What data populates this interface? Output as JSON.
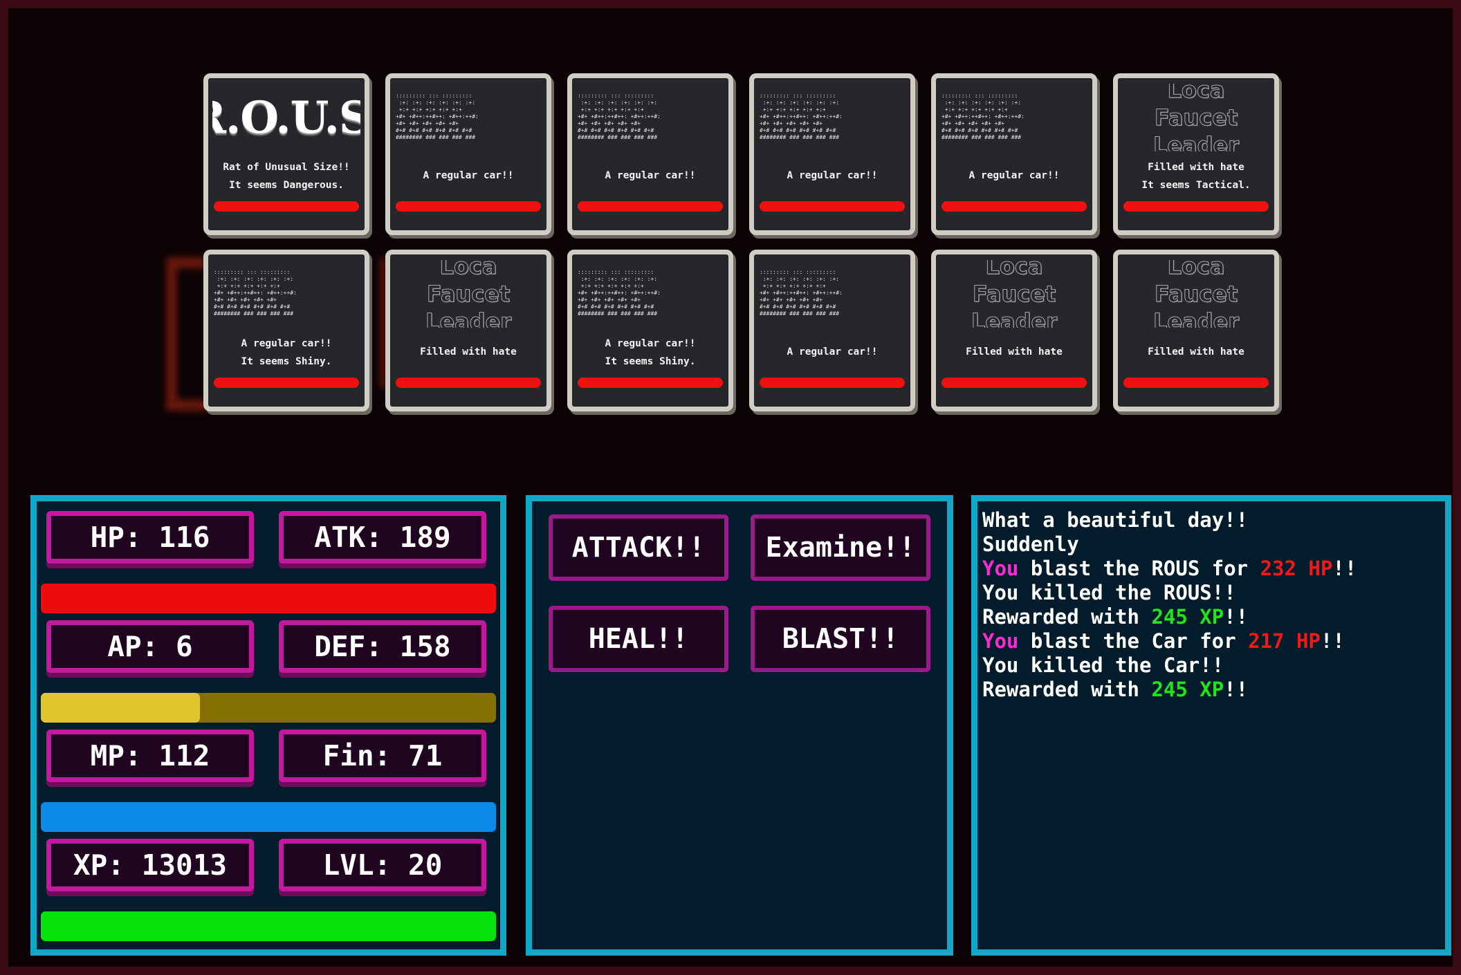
{
  "enemies": [
    {
      "art": "ROUS",
      "art_text": "R.O.U.S.",
      "line1": "Rat of Unusual Size!!",
      "line2": "It seems Dangerous.",
      "hp_fraction": 1.0
    },
    {
      "art": "car",
      "line1": "A regular car!!",
      "line2": "",
      "hp_fraction": 1.0
    },
    {
      "art": "car",
      "line1": "A regular car!!",
      "line2": "",
      "hp_fraction": 1.0
    },
    {
      "art": "car",
      "line1": "A regular car!!",
      "line2": "",
      "hp_fraction": 1.0
    },
    {
      "art": "car",
      "line1": "A regular car!!",
      "line2": "",
      "hp_fraction": 1.0
    },
    {
      "art": "loca",
      "art_lines": [
        "Loca",
        "Faucet",
        "Leader"
      ],
      "line1": "Filled with hate",
      "line2": "It seems Tactical.",
      "hp_fraction": 1.0
    },
    {
      "art": "car",
      "line1": "A regular car!!",
      "line2": "It seems Shiny.",
      "hp_fraction": 1.0
    },
    {
      "art": "loca",
      "art_lines": [
        "Loca",
        "Faucet",
        "Leader"
      ],
      "line1": "Filled with hate",
      "line2": "",
      "hp_fraction": 1.0
    },
    {
      "art": "car",
      "line1": "A regular car!!",
      "line2": "It seems Shiny.",
      "hp_fraction": 1.0
    },
    {
      "art": "car",
      "line1": "A regular car!!",
      "line2": "",
      "hp_fraction": 1.0
    },
    {
      "art": "loca",
      "art_lines": [
        "Loca",
        "Faucet",
        "Leader"
      ],
      "line1": "Filled with hate",
      "line2": "",
      "hp_fraction": 1.0
    },
    {
      "art": "loca",
      "art_lines": [
        "Loca",
        "Faucet",
        "Leader"
      ],
      "line1": "Filled with hate",
      "line2": "",
      "hp_fraction": 1.0
    }
  ],
  "stats": {
    "hp": "HP: 116",
    "atk": "ATK: 189",
    "ap": "AP: 6",
    "def": "DEF: 158",
    "mp": "MP: 112",
    "fin": "Fin: 71",
    "xp": "XP: 13013",
    "lvl": "LVL: 20"
  },
  "bars": {
    "hp": {
      "fraction": 1.0,
      "fill": "#ee0b0b",
      "track": "#ee0b0b"
    },
    "ap": {
      "fraction": 0.35,
      "fill": "#e2c42c",
      "track": "#847000"
    },
    "mp": {
      "fraction": 1.0,
      "fill": "#0c8ae8",
      "track": "#0c8ae8"
    },
    "xp": {
      "fraction": 1.0,
      "fill": "#06e20c",
      "track": "#06e20c"
    }
  },
  "actions": {
    "attack": "ATTACK!!",
    "examine": "Examine!!",
    "heal": "HEAL!!",
    "blast": "BLAST!!"
  },
  "log": [
    [
      {
        "t": "What a beautiful day!!"
      }
    ],
    [
      {
        "t": "Suddenly"
      }
    ],
    [
      {
        "t": "You",
        "c": "you"
      },
      {
        "t": " blast the ROUS for "
      },
      {
        "t": "232 HP",
        "c": "red"
      },
      {
        "t": "!!"
      }
    ],
    [
      {
        "t": "You killed the ROUS!!"
      }
    ],
    [
      {
        "t": "Rewarded with "
      },
      {
        "t": "245 XP",
        "c": "green"
      },
      {
        "t": "!!"
      }
    ],
    [
      {
        "t": "You",
        "c": "you"
      },
      {
        "t": " blast the Car for "
      },
      {
        "t": "217 HP",
        "c": "red"
      },
      {
        "t": "!!"
      }
    ],
    [
      {
        "t": "You killed the Car!!"
      }
    ],
    [
      {
        "t": "Rewarded with "
      },
      {
        "t": "245 XP",
        "c": "green"
      },
      {
        "t": "!!"
      }
    ]
  ],
  "colors": {
    "stat_border": "#c4199f",
    "panel_border": "#0fa9c7",
    "card_border": "#cfcdc4",
    "you": "#ff2ad4",
    "damage": "#f01818",
    "xp": "#22e41a"
  }
}
